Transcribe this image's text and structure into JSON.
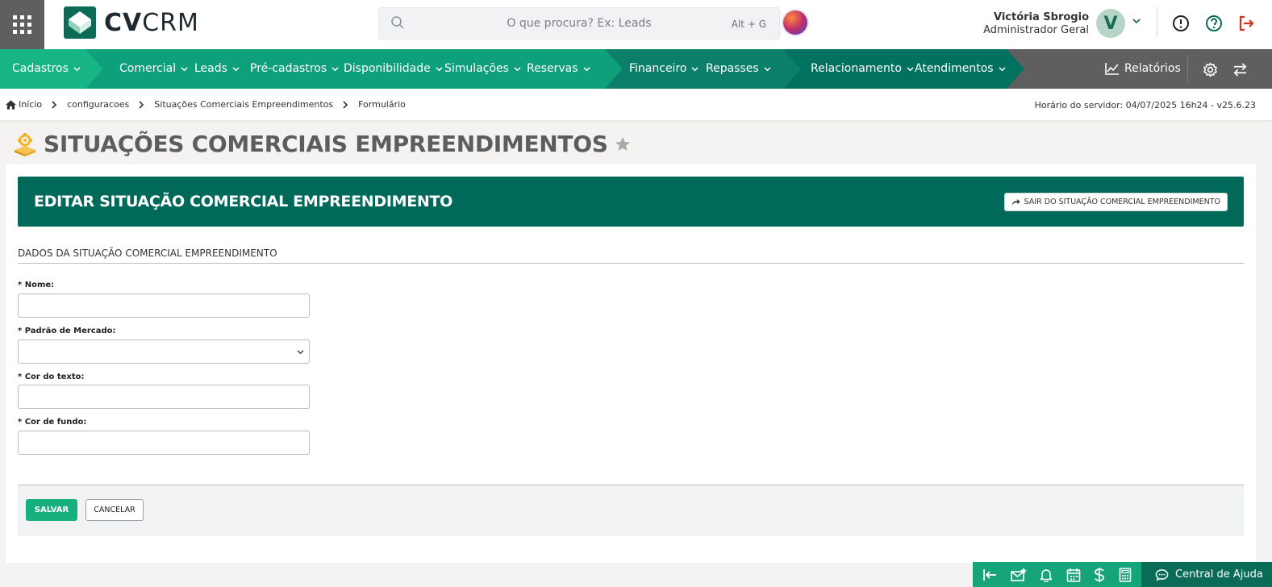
{
  "brand": {
    "logo_bold": "CV",
    "logo_light": "CRM"
  },
  "search": {
    "placeholder": "O que procura? Ex: Leads",
    "shortcut": "Alt + G"
  },
  "user": {
    "name": "Victória Sbrogio",
    "role": "Administrador Geral",
    "initial": "V"
  },
  "nav": {
    "items": [
      {
        "label": "Cadastros"
      },
      {
        "label": "Comercial"
      },
      {
        "label": "Leads"
      },
      {
        "label": "Pré-cadastros"
      },
      {
        "label": "Disponibilidade"
      },
      {
        "label": "Simulações"
      },
      {
        "label": "Reservas"
      },
      {
        "label": "Financeiro"
      },
      {
        "label": "Repasses"
      },
      {
        "label": "Relacionamento"
      },
      {
        "label": "Atendimentos"
      }
    ],
    "reports_label": "Relatórios"
  },
  "breadcrumb": [
    "Início",
    "configuracoes",
    "Situações Comerciais Empreendimentos",
    "Formulário"
  ],
  "server_time": "Horário do servidor: 04/07/2025 16h24 - v25.6.23",
  "page": {
    "title": "SITUAÇÕES COMERCIAIS EMPREENDIMENTOS"
  },
  "card": {
    "title": "EDITAR SITUAÇÃO COMERCIAL EMPREENDIMENTO",
    "exit_label": "SAIR DO SITUAÇÃO COMERCIAL EMPREENDIMENTO",
    "section_title": "DADOS DA SITUAÇÃO COMERCIAL EMPREENDIMENTO"
  },
  "form": {
    "fields": [
      {
        "label": "* Nome:",
        "value": ""
      },
      {
        "label": "* Padrão de Mercado:",
        "value": ""
      },
      {
        "label": "* Cor do texto:",
        "value": ""
      },
      {
        "label": "* Cor de fundo:",
        "value": ""
      }
    ],
    "save_label": "SALVAR",
    "cancel_label": "CANCELAR"
  },
  "dock": {
    "help_label": "Central de Ajuda"
  },
  "colors": {
    "primary_dark": "#00695a",
    "primary": "#16a57b",
    "nav_gray": "#5f5f5f",
    "logout_red": "#d93025"
  }
}
